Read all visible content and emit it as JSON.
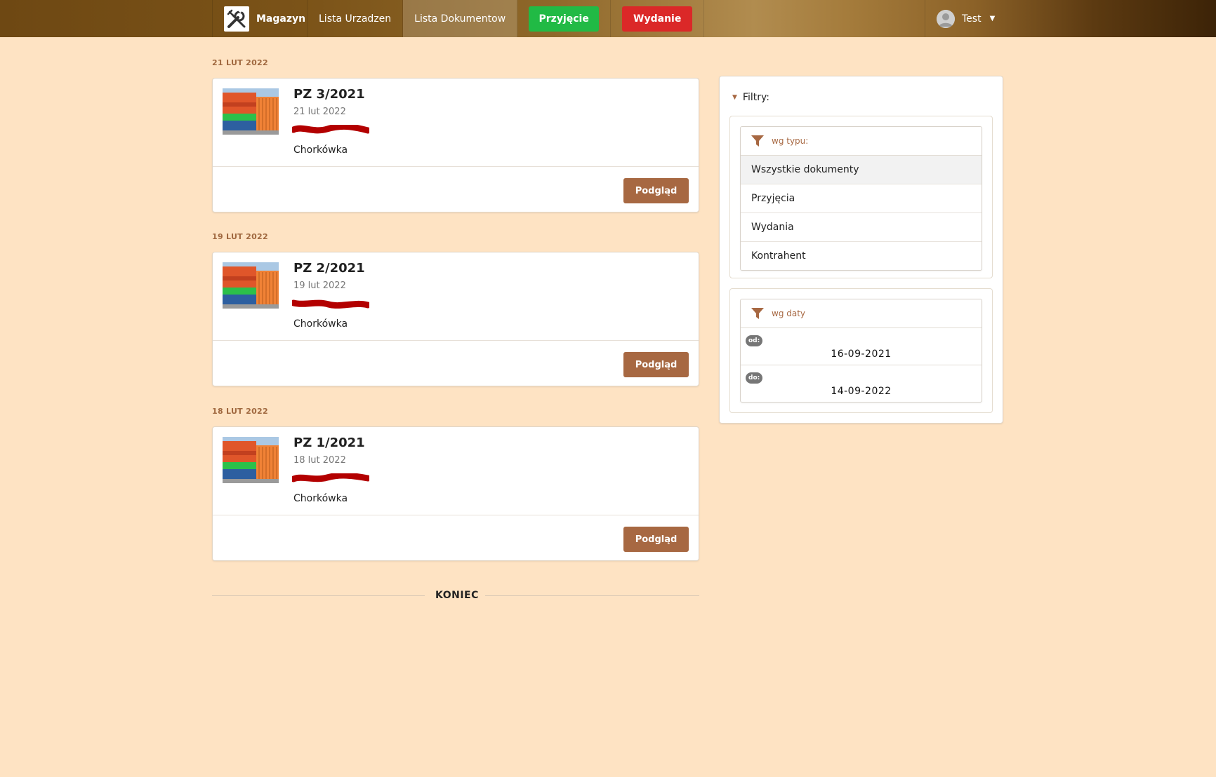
{
  "nav": {
    "brand": "Magazyn",
    "links": [
      "Lista Urzadzen",
      "Lista Dokumentow"
    ],
    "receive_label": "Przyjęcie",
    "issue_label": "Wydanie",
    "user": "Test"
  },
  "documents": [
    {
      "group_date": "21 LUT 2022",
      "title": "PZ 3/2021",
      "date": "21 lut 2022",
      "place": "Chorkówka",
      "button": "Podgląd"
    },
    {
      "group_date": "19 LUT 2022",
      "title": "PZ 2/2021",
      "date": "19 lut 2022",
      "place": "Chorkówka",
      "button": "Podgląd"
    },
    {
      "group_date": "18 LUT 2022",
      "title": "PZ 1/2021",
      "date": "18 lut 2022",
      "place": "Chorkówka",
      "button": "Podgląd"
    }
  ],
  "end_label": "KONIEC",
  "filters": {
    "title": "Filtry:",
    "type_header": "wg typu:",
    "type_options": [
      "Wszystkie dokumenty",
      "Przyjęcia",
      "Wydania",
      "Kontrahent"
    ],
    "selected_type": "Wszystkie dokumenty",
    "date_header": "wg daty",
    "from_label": "od:",
    "from_value": "16-09-2021",
    "to_label": "do:",
    "to_value": "14-09-2022"
  },
  "colors": {
    "background": "#fee3c3",
    "accent": "#a76842",
    "receive": "#21ba45",
    "issue": "#db2828",
    "redaction": "#b30000"
  }
}
